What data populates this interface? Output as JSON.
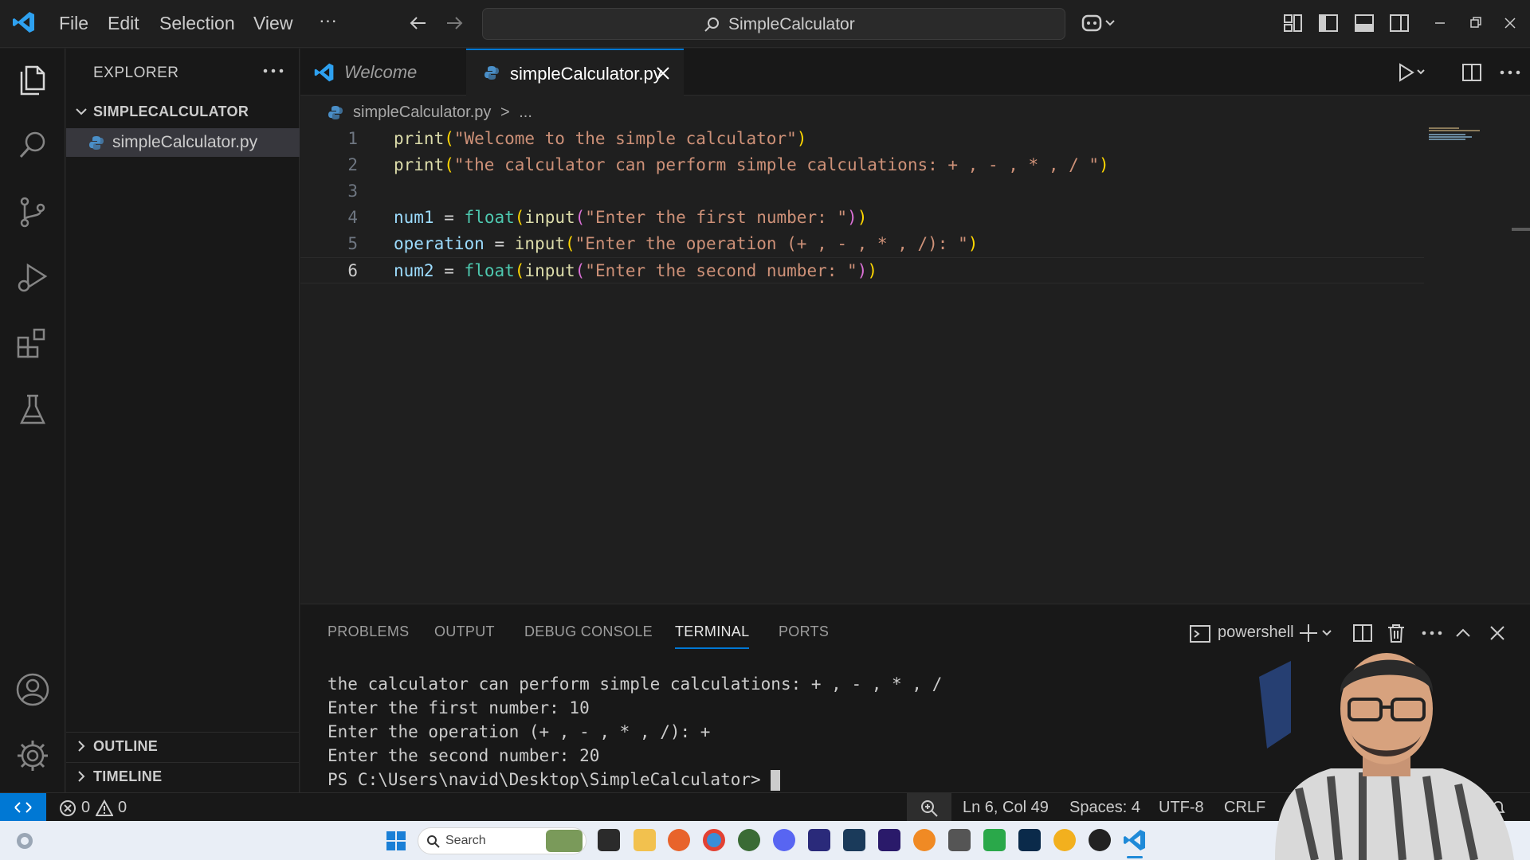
{
  "menu": {
    "file": "File",
    "edit": "Edit",
    "selection": "Selection",
    "view": "View",
    "more": "···"
  },
  "command_center": {
    "label": "SimpleCalculator"
  },
  "sidebar": {
    "title": "EXPLORER",
    "folder": "SIMPLECALCULATOR",
    "file": "simpleCalculator.py",
    "outline": "OUTLINE",
    "timeline": "TIMELINE"
  },
  "tabs": [
    {
      "label": "Welcome"
    },
    {
      "label": "simpleCalculator.py"
    }
  ],
  "breadcrumb": {
    "file": "simpleCalculator.py",
    "separator": ">",
    "rest": "..."
  },
  "editor": {
    "line_numbers": [
      "1",
      "2",
      "3",
      "4",
      "5",
      "6"
    ],
    "current_line": 6,
    "lines": [
      "print(\"Welcome to the simple calculator\")",
      "print(\"the calculator can perform simple calculations: + , - , * , / \")",
      "",
      "num1 = float(input(\"Enter the first number: \"))",
      "operation = input(\"Enter the operation (+ , - , * , /): \")",
      "num2 = float(input(\"Enter the second number: \"))"
    ],
    "tokens": {
      "print": "print",
      "float": "float",
      "input": "input",
      "num1": "num1",
      "num2": "num2",
      "operation": "operation",
      "eq": "=",
      "s1": "\"Welcome to the simple calculator\"",
      "s2": "\"the calculator can perform simple calculations: + , - , * , / \"",
      "s4": "\"Enter the first number: \"",
      "s5": "\"Enter the operation (+ , - , * , /): \"",
      "s6": "\"Enter the second number: \""
    }
  },
  "panel": {
    "tabs": [
      "PROBLEMS",
      "OUTPUT",
      "DEBUG CONSOLE",
      "TERMINAL",
      "PORTS"
    ],
    "active_tab": "TERMINAL",
    "profile": "powershell",
    "terminal_lines": [
      "the calculator can perform simple calculations: + , - , * , /",
      "Enter the first number: 10",
      "Enter the operation (+ , - , * , /): +",
      "Enter the second number: 20"
    ],
    "prompt": "PS C:\\Users\\navid\\Desktop\\SimpleCalculator>"
  },
  "statusbar": {
    "errors": "0",
    "warnings": "0",
    "position": "Ln 6, Col 49",
    "spaces": "Spaces: 4",
    "encoding": "UTF-8",
    "eol": "CRLF"
  },
  "taskbar": {
    "search_placeholder": "Search"
  },
  "colors": {
    "accent": "#0078d4",
    "string": "#ce9178",
    "function": "#dcdcaa",
    "variable": "#9cdcfe"
  },
  "icons": [
    "vscode-logo-icon",
    "files-icon",
    "search-icon",
    "source-control-icon",
    "run-debug-icon",
    "extensions-icon",
    "testing-icon",
    "account-icon",
    "gear-icon",
    "python-file-icon",
    "close-icon",
    "run-icon",
    "split-editor-icon",
    "terminal-icon",
    "trash-icon",
    "bell-icon",
    "remote-icon",
    "zoom-icon",
    "windows-start-icon"
  ]
}
